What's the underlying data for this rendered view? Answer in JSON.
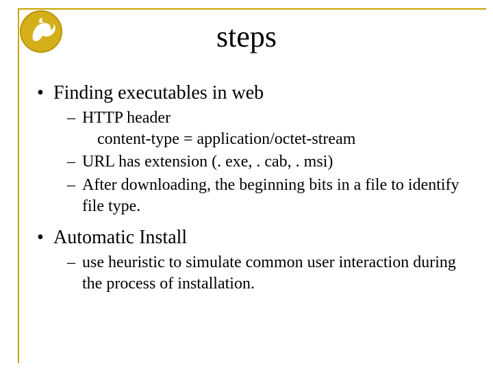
{
  "title": "steps",
  "bullets": [
    {
      "label": "Finding executables in web",
      "sub": [
        {
          "label": "HTTP header",
          "extra": "content-type = application/octet-stream"
        },
        {
          "label": "URL has extension (. exe, . cab, . msi)"
        },
        {
          "label": "After downloading, the beginning bits in a file to identify file type."
        }
      ]
    },
    {
      "label": "Automatic Install",
      "sub": [
        {
          "label": "use heuristic to simulate common user interaction during the process of installation."
        }
      ]
    }
  ]
}
